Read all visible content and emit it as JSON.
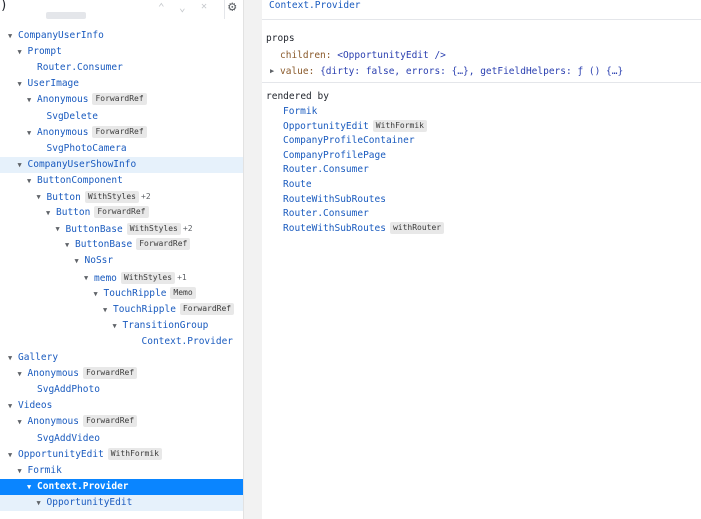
{
  "toolbar": {
    "paren": ")",
    "up_icon": "⌃",
    "down_icon": "⌄",
    "close_icon": "✕",
    "settings_icon": "⚙"
  },
  "tree": [
    {
      "depth": 0,
      "name": "CompanyUserInfo",
      "arrow": "▼"
    },
    {
      "depth": 1,
      "name": "Prompt",
      "arrow": "▼"
    },
    {
      "depth": 2,
      "name": "Router.Consumer",
      "arrow": ""
    },
    {
      "depth": 1,
      "name": "UserImage",
      "arrow": "▼"
    },
    {
      "depth": 2,
      "name": "Anonymous",
      "badge": "ForwardRef",
      "arrow": "▼"
    },
    {
      "depth": 3,
      "name": "SvgDelete",
      "arrow": ""
    },
    {
      "depth": 2,
      "name": "Anonymous",
      "badge": "ForwardRef",
      "arrow": "▼"
    },
    {
      "depth": 3,
      "name": "SvgPhotoCamera",
      "arrow": ""
    },
    {
      "depth": 1,
      "name": "CompanyUserShowInfo",
      "arrow": "▼",
      "state": "hl"
    },
    {
      "depth": 2,
      "name": "ButtonComponent",
      "arrow": "▼"
    },
    {
      "depth": 3,
      "name": "Button",
      "badge": "WithStyles",
      "more": "+2",
      "arrow": "▼"
    },
    {
      "depth": 4,
      "name": "Button",
      "badge": "ForwardRef",
      "arrow": "▼"
    },
    {
      "depth": 5,
      "name": "ButtonBase",
      "badge": "WithStyles",
      "more": "+2",
      "arrow": "▼"
    },
    {
      "depth": 6,
      "name": "ButtonBase",
      "badge": "ForwardRef",
      "arrow": "▼"
    },
    {
      "depth": 7,
      "name": "NoSsr",
      "arrow": "▼"
    },
    {
      "depth": 8,
      "name": "memo",
      "badge": "WithStyles",
      "more": "+1",
      "arrow": "▼"
    },
    {
      "depth": 9,
      "name": "TouchRipple",
      "badge": "Memo",
      "arrow": "▼"
    },
    {
      "depth": 10,
      "name": "TouchRipple",
      "badge": "ForwardRef",
      "arrow": "▼"
    },
    {
      "depth": 11,
      "name": "TransitionGroup",
      "arrow": "▼"
    },
    {
      "depth": 13,
      "name": "Context.Provider",
      "arrow": ""
    },
    {
      "depth": 0,
      "name": "Gallery",
      "arrow": "▼"
    },
    {
      "depth": 1,
      "name": "Anonymous",
      "badge": "ForwardRef",
      "arrow": "▼"
    },
    {
      "depth": 2,
      "name": "SvgAddPhoto",
      "arrow": ""
    },
    {
      "depth": 0,
      "name": "Videos",
      "arrow": "▼"
    },
    {
      "depth": 1,
      "name": "Anonymous",
      "badge": "ForwardRef",
      "arrow": "▼"
    },
    {
      "depth": 2,
      "name": "SvgAddVideo",
      "arrow": ""
    },
    {
      "depth": 0,
      "name": "OpportunityEdit",
      "badge": "WithFormik",
      "arrow": "▼"
    },
    {
      "depth": 1,
      "name": "Formik",
      "arrow": "▼"
    },
    {
      "depth": 2,
      "name": "Context.Provider",
      "arrow": "▼",
      "state": "sel"
    },
    {
      "depth": 3,
      "name": "OpportunityEdit",
      "arrow": "▼",
      "state": "hl"
    }
  ],
  "details": {
    "title": "Context.Provider",
    "props_header": "props",
    "children_key": "children:",
    "children_val": "<OpportunityEdit />",
    "value_key": "value:",
    "value_val": "{dirty: false, errors: {…}, getFieldHelpers: ƒ () {…}",
    "rendered_by_header": "rendered by",
    "rendered_by": [
      {
        "name": "Formik"
      },
      {
        "name": "OpportunityEdit",
        "badge": "WithFormik"
      },
      {
        "name": "CompanyProfileContainer"
      },
      {
        "name": "CompanyProfilePage"
      },
      {
        "name": "Router.Consumer"
      },
      {
        "name": "Route"
      },
      {
        "name": "RouteWithSubRoutes"
      },
      {
        "name": "Router.Consumer"
      },
      {
        "name": "RouteWithSubRoutes",
        "badge": "withRouter"
      }
    ]
  },
  "colors": {
    "selected_row": "#0a85ff",
    "hover_row": "#e6f1fb",
    "component_name": "#1a5bbf",
    "badge_bg": "#e8e8e8"
  }
}
